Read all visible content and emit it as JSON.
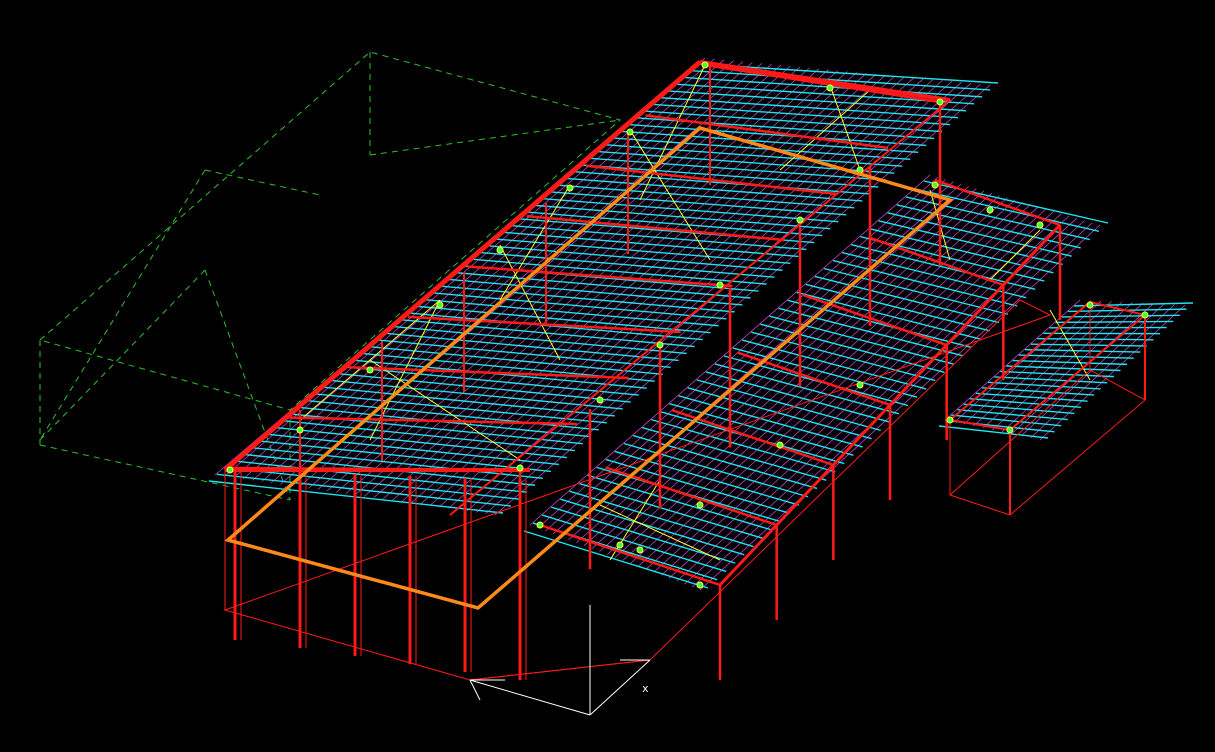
{
  "colors": {
    "background": "#000000",
    "frame": "#ff1a1a",
    "purlin": "#19e6f0",
    "deck": "#e040e0",
    "bracing": "#ffff33",
    "perimeter": "#ff8a1a",
    "envelope": "#2fbf2f",
    "axes": "#ffffff",
    "connection": "#40ff40"
  },
  "axes": {
    "x_label": "x"
  },
  "layers": [
    {
      "name": "envelope",
      "icon": "dashed-box-icon"
    },
    {
      "name": "deck",
      "icon": "deck-icon"
    },
    {
      "name": "purlins",
      "icon": "purlin-icon"
    },
    {
      "name": "frames",
      "icon": "frame-icon"
    },
    {
      "name": "bracing",
      "icon": "bracing-icon"
    },
    {
      "name": "perimeter",
      "icon": "perimeter-icon"
    }
  ]
}
